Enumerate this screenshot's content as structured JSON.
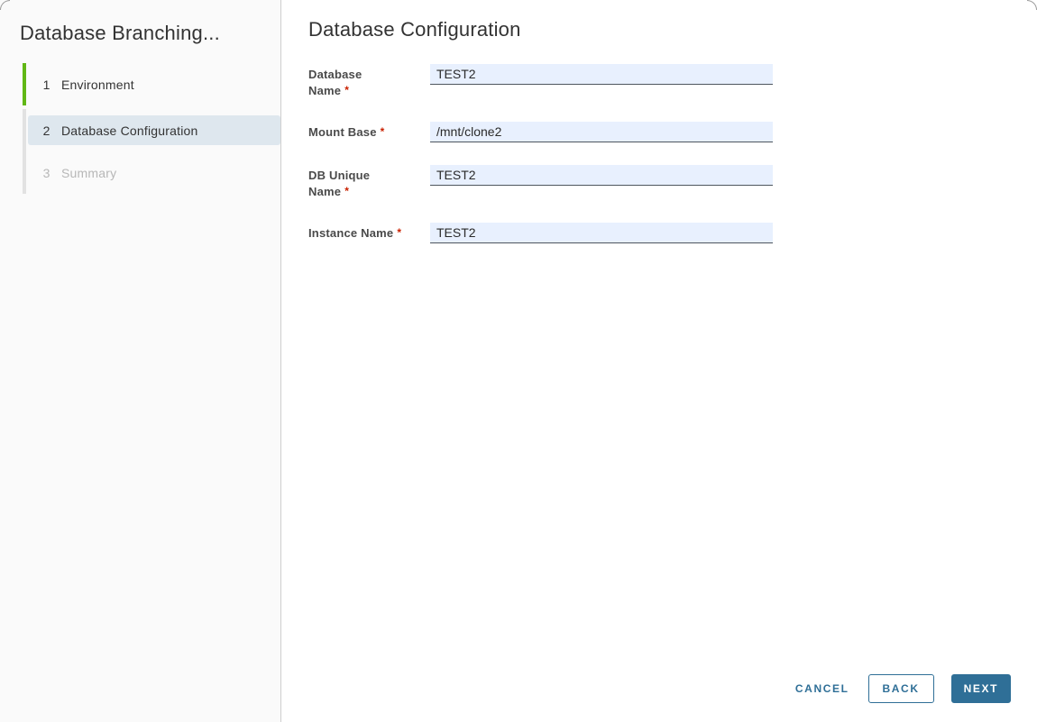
{
  "colors": {
    "accent_blue": "#2f6f97",
    "step_green": "#61b715",
    "required_red": "#c92100",
    "input_bg": "#e8f0fe",
    "current_step_bg": "#dee7ee",
    "sidebar_bg": "#fafafa"
  },
  "sidebar": {
    "title": "Database Branching...",
    "steps": [
      {
        "number": "1",
        "label": "Environment",
        "state": "completed"
      },
      {
        "number": "2",
        "label": "Database Configuration",
        "state": "current"
      },
      {
        "number": "3",
        "label": "Summary",
        "state": "upcoming"
      }
    ]
  },
  "main": {
    "title": "Database Configuration",
    "fields": [
      {
        "label": "Database Name",
        "lines": [
          "Database",
          "Name"
        ],
        "required_mark": "*",
        "value": "TEST2"
      },
      {
        "label": "Mount Base",
        "lines": [
          "Mount Base"
        ],
        "required_mark": "*",
        "value": "/mnt/clone2"
      },
      {
        "label": "DB Unique Name",
        "lines": [
          "DB Unique",
          "Name"
        ],
        "required_mark": "*",
        "value": "TEST2"
      },
      {
        "label": "Instance Name",
        "lines": [
          "Instance Name"
        ],
        "required_mark": "*",
        "value": "TEST2"
      }
    ]
  },
  "footer": {
    "cancel_label": "CANCEL",
    "back_label": "BACK",
    "next_label": "NEXT"
  }
}
